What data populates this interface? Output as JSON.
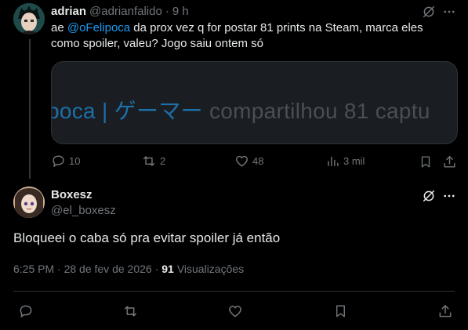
{
  "tweet1": {
    "author_name": "adrian",
    "author_handle": "@adrianfalido",
    "separator": "·",
    "time": "9 h",
    "text_prefix": "ae ",
    "mention": "@oFelipoca",
    "text_suffix": " da prox vez q for postar 81 prints na Steam, marca eles como spoiler, valeu? Jogo saiu ontem só",
    "card": {
      "brand_text": "poca | ゲーマー",
      "rest_text": " compartilhou 81 captu"
    },
    "actions": {
      "replies": "10",
      "reposts": "2",
      "likes": "48",
      "views": "3 mil"
    }
  },
  "tweet2": {
    "author_name": "Boxesz",
    "author_handle": "@el_boxesz",
    "text": "Bloqueei o caba só pra evitar spoiler já então",
    "timestamp": "6:25 PM · 28 de fev de 2026 ·",
    "views_count": "91",
    "views_label": "Visualizações"
  },
  "icons": [
    "grok-icon",
    "more-icon",
    "reply-icon",
    "repost-icon",
    "like-icon",
    "views-icon",
    "bookmark-icon",
    "share-icon"
  ],
  "colors": {
    "background": "#000000",
    "text": "#e7e9ea",
    "muted": "#71767b",
    "link": "#1d9bf0",
    "divider": "#2f3336"
  }
}
